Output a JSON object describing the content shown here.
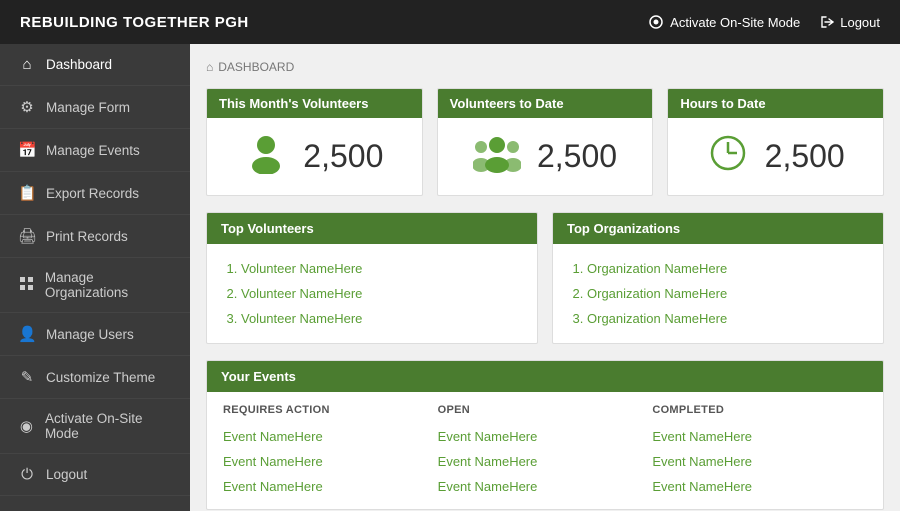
{
  "app": {
    "title": "REBUILDING TOGETHER PGH",
    "activate_onsite_label": "Activate On-Site Mode",
    "logout_label": "Logout"
  },
  "sidebar": {
    "items": [
      {
        "id": "dashboard",
        "label": "Dashboard",
        "icon": "⌂"
      },
      {
        "id": "manage-form",
        "label": "Manage Form",
        "icon": "⚙"
      },
      {
        "id": "manage-events",
        "label": "Manage Events",
        "icon": "📅"
      },
      {
        "id": "export-records",
        "label": "Export Records",
        "icon": "⬆"
      },
      {
        "id": "print-records",
        "label": "Print Records",
        "icon": "🖨"
      },
      {
        "id": "manage-organizations",
        "label": "Manage Organizations",
        "icon": "⊞"
      },
      {
        "id": "manage-users",
        "label": "Manage Users",
        "icon": "👤"
      },
      {
        "id": "customize-theme",
        "label": "Customize Theme",
        "icon": "✏"
      },
      {
        "id": "activate-onsite",
        "label": "Activate On-Site Mode",
        "icon": "⊙"
      },
      {
        "id": "logout",
        "label": "Logout",
        "icon": "⏻"
      }
    ]
  },
  "breadcrumb": {
    "icon": "⌂",
    "label": "DASHBOARD"
  },
  "stats": [
    {
      "header": "This Month's Volunteers",
      "value": "2,500",
      "icon_type": "person"
    },
    {
      "header": "Volunteers to Date",
      "value": "2,500",
      "icon_type": "group"
    },
    {
      "header": "Hours to Date",
      "value": "2,500",
      "icon_type": "clock"
    }
  ],
  "top_volunteers": {
    "header": "Top Volunteers",
    "items": [
      "Volunteer NameHere",
      "Volunteer NameHere",
      "Volunteer NameHere"
    ]
  },
  "top_organizations": {
    "header": "Top Organizations",
    "items": [
      "Organization NameHere",
      "Organization NameHere",
      "Organization NameHere"
    ]
  },
  "events": {
    "header": "Your Events",
    "columns": [
      {
        "header": "REQUIRES ACTION",
        "items": [
          "Event NameHere",
          "Event NameHere",
          "Event NameHere"
        ]
      },
      {
        "header": "OPEN",
        "items": [
          "Event NameHere",
          "Event NameHere",
          "Event NameHere"
        ]
      },
      {
        "header": "COMPLETED",
        "items": [
          "Event NameHere",
          "Event NameHere",
          "Event NameHere"
        ]
      }
    ]
  }
}
